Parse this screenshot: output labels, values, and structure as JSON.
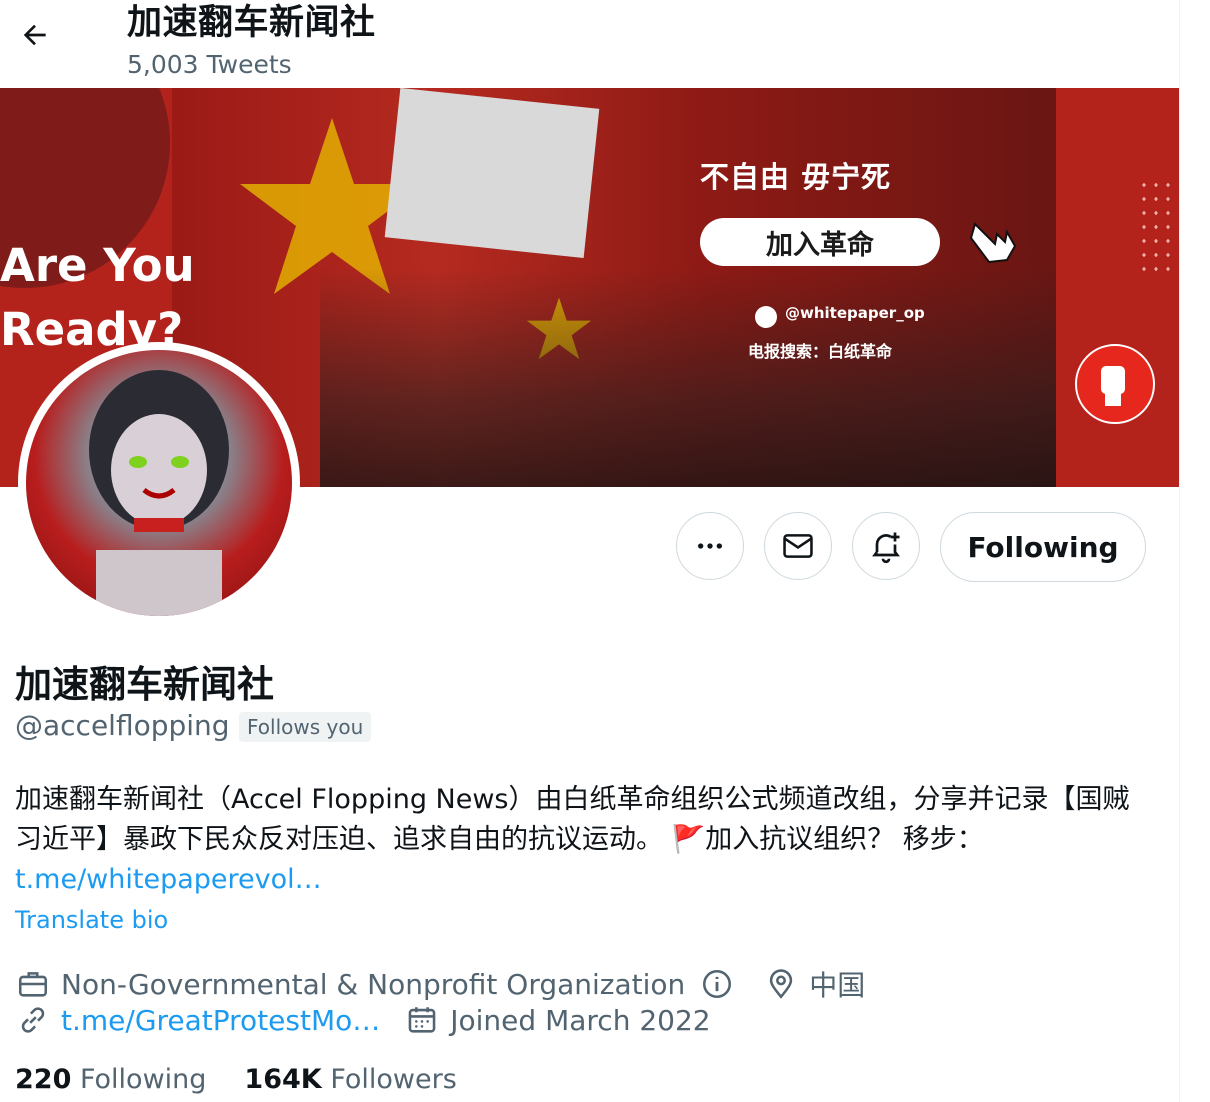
{
  "header": {
    "title": "加速翻车新闻社",
    "tweet_count": "5,003 Tweets"
  },
  "banner": {
    "left_text_line1": "Are You",
    "left_text_line2": "Ready?",
    "slogan": "不自由 毋宁死",
    "join_button": "加入革命",
    "twitter_handle": "@whitepaper_op",
    "telegram": "电报搜索：白纸革命"
  },
  "actions": {
    "more_icon": "more-dots-icon",
    "message_icon": "envelope-icon",
    "notify_icon": "bell-plus-icon",
    "follow_label": "Following"
  },
  "profile": {
    "name": "加速翻车新闻社",
    "handle": "@accelflopping",
    "follows_you": "Follows you",
    "bio_text": "加速翻车新闻社（Accel Flopping News）由白纸革命组织公式频道改组，分享并记录【国贼习近平】暴政下民众反对压迫、追求自由的抗议运动。 🚩加入抗议组织？ 移步：",
    "bio_link": "t.me/whitepaperevol…",
    "translate": "Translate bio",
    "category": "Non-Governmental & Nonprofit Organization",
    "location": "中国",
    "website": "t.me/GreatProtestMo…",
    "joined": "Joined March 2022"
  },
  "stats": {
    "following_count": "220",
    "following_label": "Following",
    "followers_count": "164K",
    "followers_label": "Followers"
  },
  "colors": {
    "link": "#1d9bf0",
    "secondary_text": "#536471",
    "banner_red": "#b4221c"
  }
}
